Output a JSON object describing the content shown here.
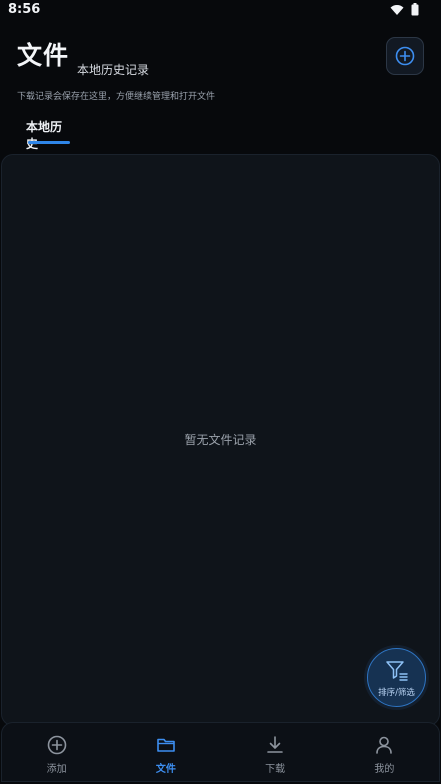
{
  "status_bar": {
    "time": "8:56"
  },
  "header": {
    "title": "文件",
    "subtitle": "本地历史记录",
    "description": "下载记录会保存在这里，方便继续管理和打开文件"
  },
  "tabs": [
    {
      "label": "本地历史",
      "active": true
    }
  ],
  "content": {
    "empty_text": "暂无文件记录"
  },
  "fab": {
    "label": "排序/筛选"
  },
  "bottom_nav": [
    {
      "label": "添加",
      "icon": "plus-circle-icon",
      "active": false
    },
    {
      "label": "文件",
      "icon": "folder-icon",
      "active": true
    },
    {
      "label": "下载",
      "icon": "download-icon",
      "active": false
    },
    {
      "label": "我的",
      "icon": "user-icon",
      "active": false
    }
  ],
  "colors": {
    "accent": "#2f86e8",
    "background": "#07090c",
    "panel": "#0f141a"
  }
}
